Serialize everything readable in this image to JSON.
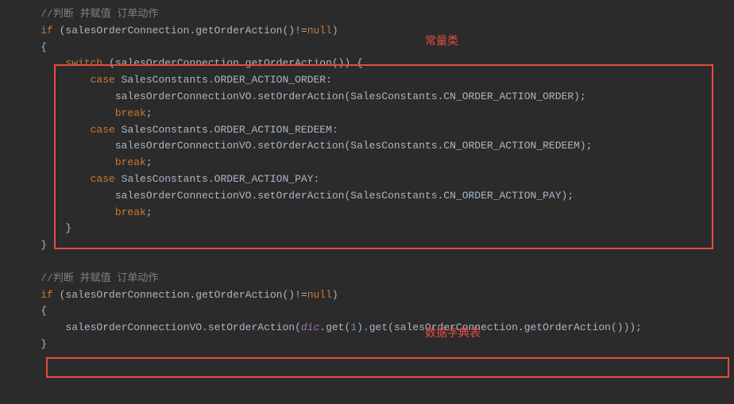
{
  "annotations": {
    "label1": "常量类",
    "label2": "数据字典表"
  },
  "code": {
    "line1_comment": "//判断 并赋值 订单动作",
    "line2_if": "if",
    "line2_cond": " (salesOrderConnection.getOrderAction()!=",
    "line2_null": "null",
    "line2_close": ")",
    "line3_brace": "{",
    "line4_switch": "switch",
    "line4_cond": " (salesOrderConnection.getOrderAction()) {",
    "line5_case": "case",
    "line5_val": " SalesConstants.ORDER_ACTION_ORDER:",
    "line6_stmt": "salesOrderConnectionVO.setOrderAction(SalesConstants.CN_ORDER_ACTION_ORDER);",
    "line7_break": "break",
    "line7_semi": ";",
    "line8_case": "case",
    "line8_val": " SalesConstants.ORDER_ACTION_REDEEM:",
    "line9_stmt": "salesOrderConnectionVO.setOrderAction(SalesConstants.CN_ORDER_ACTION_REDEEM);",
    "line10_break": "break",
    "line10_semi": ";",
    "line11_case": "case",
    "line11_val": " SalesConstants.ORDER_ACTION_PAY:",
    "line12_stmt": "salesOrderConnectionVO.setOrderAction(SalesConstants.CN_ORDER_ACTION_PAY);",
    "line13_break": "break",
    "line13_semi": ";",
    "line14_brace": "}",
    "line15_brace": "}",
    "line17_comment": "//判断 并赋值 订单动作",
    "line18_if": "if",
    "line18_cond": " (salesOrderConnection.getOrderAction()!=",
    "line18_null": "null",
    "line18_close": ")",
    "line19_brace": "{",
    "line20_pre": "salesOrderConnectionVO.setOrderAction(",
    "line20_dic": "dic",
    "line20_mid1": ".get(",
    "line20_num": "1",
    "line20_mid2": ").get(salesOrderConnection.getOrderAction()));",
    "line21_brace": "}"
  }
}
